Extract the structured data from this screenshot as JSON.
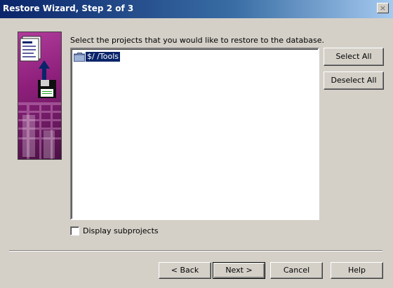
{
  "window": {
    "title": "Restore Wizard, Step 2 of 3",
    "close_glyph": "×"
  },
  "instruction": "Select the projects that you would like to restore to the database.",
  "project_list": {
    "items": [
      {
        "label": "$/      /Tools",
        "selected": true,
        "icon": "folder-icon"
      }
    ]
  },
  "side_buttons": {
    "select_all": "Select All",
    "deselect_all": "Deselect All"
  },
  "options": {
    "display_subprojects_label": "Display subprojects",
    "display_subprojects_checked": false
  },
  "nav_buttons": {
    "back": "< Back",
    "next": "Next >",
    "cancel": "Cancel",
    "help": "Help"
  },
  "colors": {
    "selection": "#0a246a",
    "art_purple": "#8e1f7b",
    "face": "#d4d0c8"
  }
}
